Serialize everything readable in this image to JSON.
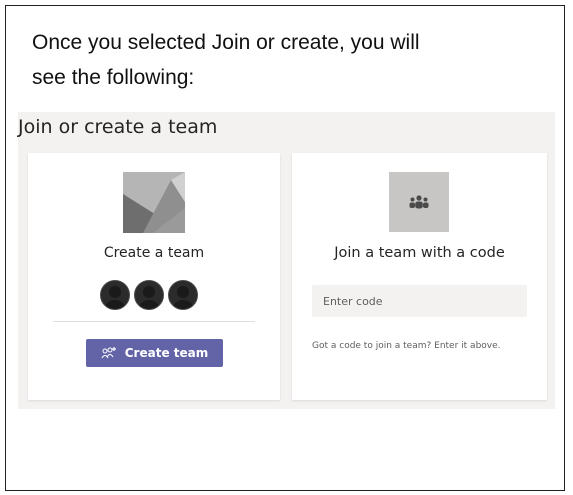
{
  "intro": {
    "line1": "Once you selected Join or create, you will",
    "line2": "see the following:"
  },
  "panel": {
    "title": "Join or create a team"
  },
  "create_card": {
    "title": "Create a team",
    "button_label": "Create team",
    "button_icon": "add-people-icon",
    "image_icon": "team-placeholder-image",
    "avatar_count": 3
  },
  "join_card": {
    "title": "Join a team with a code",
    "input_placeholder": "Enter code",
    "input_value": "",
    "hint": "Got a code to join a team? Enter it above.",
    "icon": "teams-people-icon"
  },
  "colors": {
    "accent": "#6264a7",
    "panel_background": "#f3f2f1",
    "card_background": "#ffffff",
    "icon_box": "#c8c6c4"
  }
}
